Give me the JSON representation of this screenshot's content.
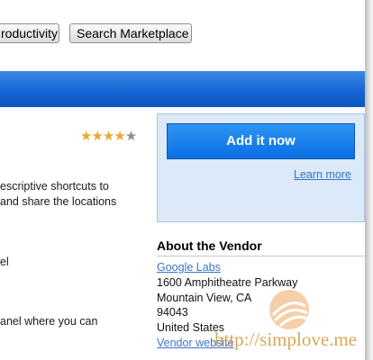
{
  "toolbar": {
    "productivity_label": "roductivity",
    "search_label": "Search Marketplace"
  },
  "listing": {
    "rating_stars": 4,
    "rating_max": 5,
    "description_lines": [
      "escriptive shortcuts to",
      "and share the locations",
      "el",
      "anel where you can"
    ]
  },
  "install": {
    "add_label": "Add it now",
    "learn_more": "Learn more"
  },
  "vendor": {
    "heading": "About the Vendor",
    "name": "Google Labs",
    "street": "1600 Amphitheatre Parkway",
    "city": "Mountain View, CA",
    "zip": "94043",
    "country": "United States",
    "website": "Vendor website"
  },
  "watermark": {
    "text": "http://simplove.me",
    "color": "#d09a3a"
  },
  "colors": {
    "bar": "#1463d2",
    "button": "#0b6fe3",
    "link": "#3a73c8",
    "star": "#e9a72e"
  }
}
